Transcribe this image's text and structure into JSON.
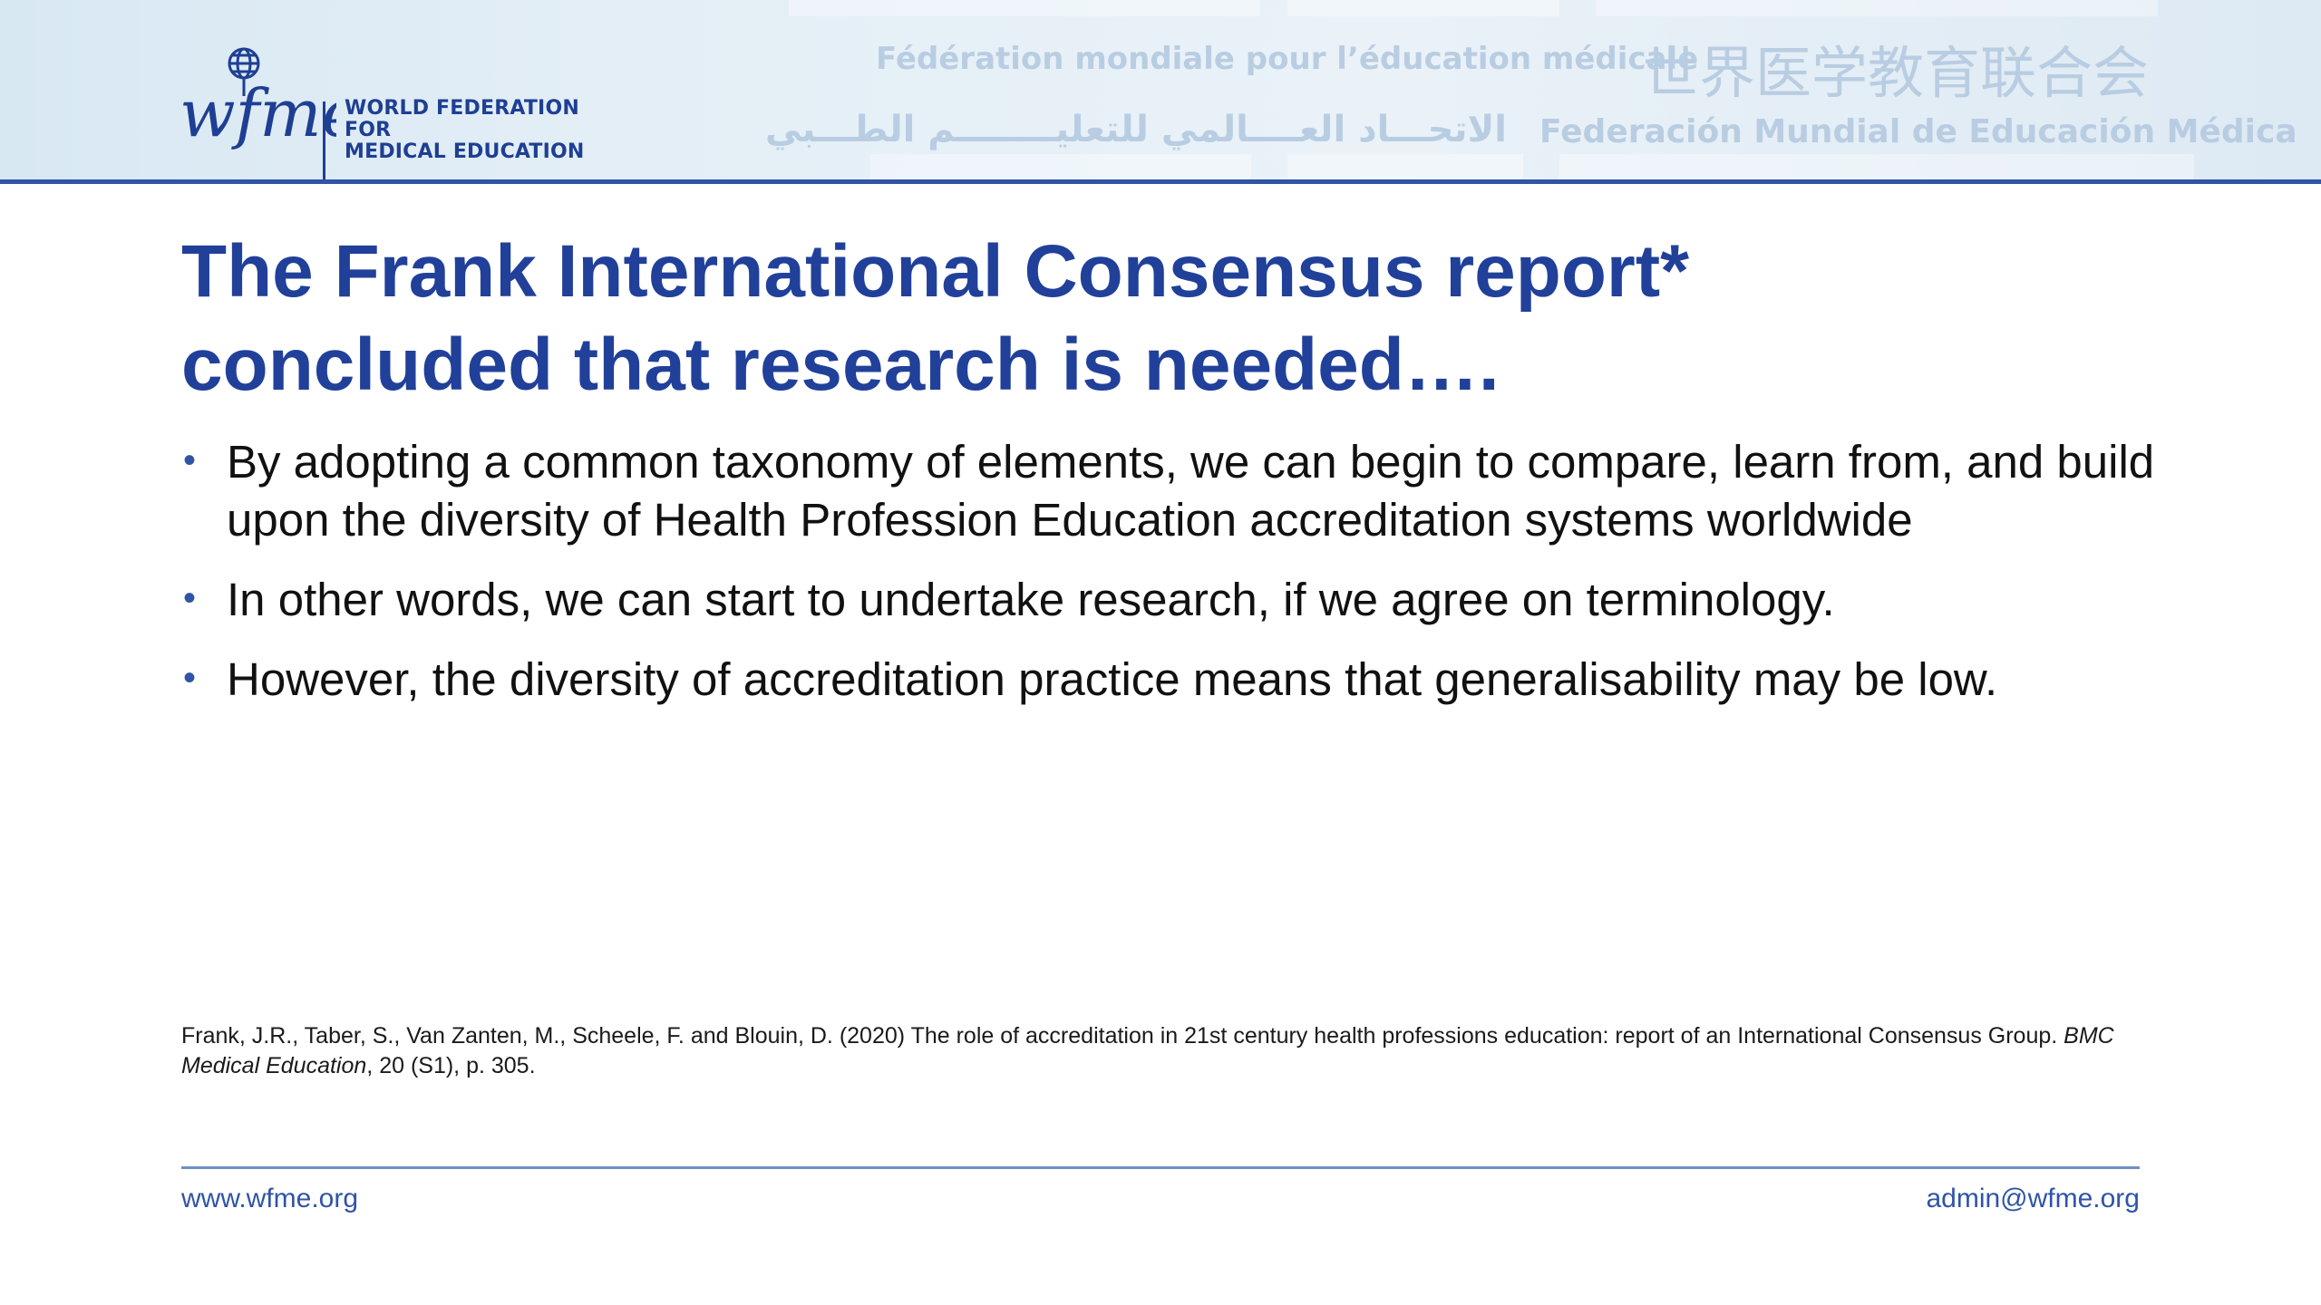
{
  "header": {
    "logo_wordmark": "wfme",
    "org_name_line1": "WORLD FEDERATION FOR",
    "org_name_line2": "MEDICAL EDUCATION",
    "lang_french": "Fédération mondiale pour l’éducation médicale",
    "lang_chinese": "世界医学教育联合会",
    "lang_arabic": "الاتحـــاد العــــالمي للتعليــــــــم الطـــبي",
    "lang_spanish": "Federación Mundial de Educación Médica"
  },
  "slide": {
    "title_line1": "The Frank International Consensus report*",
    "title_line2": "concluded that research is needed….",
    "bullets": [
      "By adopting a common taxonomy of elements, we can begin to compare, learn from, and build upon the diversity of Health Profession Education accreditation systems worldwide",
      "In other words, we can start to undertake research, if we agree on terminology.",
      "However, the diversity of accreditation practice means that generalisability may be low."
    ],
    "bullet_glyph": "•",
    "reference": {
      "text_before": "Frank, J.R., Taber, S., Van Zanten, M., Scheele, F. and Blouin, D. (2020) The role of accreditation in 21st century health professions education: report of an International Consensus Group. ",
      "journal": "BMC Medical Education",
      "text_after": ", 20 (S1), p. 305."
    }
  },
  "footer": {
    "website": "www.wfme.org",
    "email": "admin@wfme.org"
  },
  "colors": {
    "brand_blue": "#21409a",
    "header_rule": "#2f54a8",
    "footer_rule": "#6f8ec9"
  }
}
